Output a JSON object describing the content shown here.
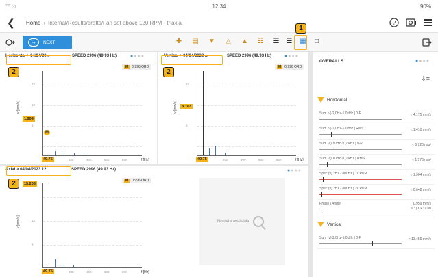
{
  "status": {
    "time": "12:34",
    "battery": "90%",
    "left": "°° ⊙"
  },
  "nav": {
    "back_icon": "chevron-left",
    "home": "Home",
    "separator": "›",
    "path": "Internal/Results/drafts/Fan set above 120 RPM - triaxial"
  },
  "toolbar": {
    "next_label": "NEXT",
    "callout": "1"
  },
  "panels": {
    "horizontal": {
      "title": "Horizontal > 04/04/20...",
      "speed": "SPEED 2996 (49.93 Hz)",
      "callout": "2",
      "mtag": "0.996 ORD",
      "ylabel": "v [mm/s]",
      "xunit": "f [Hz]",
      "yval": "1.904",
      "xval": "49.75",
      "ticks_x": [
        "200",
        "400",
        "600",
        "800"
      ],
      "ticks_y": [
        "15",
        "10",
        "5"
      ]
    },
    "vertical": {
      "title": "Vertical > 04/04/2023 ...",
      "speed": "SPEED 2996 (49.93 Hz)",
      "callout": "2",
      "mtag": "0.996 ORD",
      "ylabel": "v [mm/s]",
      "xunit": "f [Hz]",
      "yval": "8.103",
      "xval": "49.75",
      "ticks_x": [
        "200",
        "400",
        "600",
        "800"
      ],
      "ticks_y": [
        "15",
        "10",
        "5"
      ]
    },
    "axial": {
      "title": "Axial > 04/04/2023 12...",
      "speed": "SPEED 2996 (49.93 Hz)",
      "callout": "2",
      "mtag": "0.996 ORD",
      "ylabel": "v [mm/s]",
      "xunit": "f [Hz]",
      "yval": "15.208",
      "xval": "49.75",
      "ticks_x": [
        "200",
        "400",
        "600",
        "800"
      ],
      "ticks_y": [
        "10",
        "5"
      ]
    },
    "empty": {
      "text": "No data available"
    }
  },
  "overalls": {
    "title": "OVERALLS",
    "sections": [
      {
        "name": "Horizontal"
      },
      {
        "name": "Vertical"
      }
    ],
    "rows": [
      {
        "label": "Sum (v) 2,0Hz-1,0kHz | 0-P",
        "value": "≈ 4.175 mm/s"
      },
      {
        "label": "Sum (v) 2,0Hz-1,0kHz | RMS",
        "value": "≈ 1.410 mm/s"
      },
      {
        "label": "Sum (a) 10Hz-10,0kHz | 0-P",
        "value": "≈ 5.726 m/s²"
      },
      {
        "label": "Sum (a) 10Hz-10,0kHz | RMS",
        "value": "≈ 1.578 m/s²"
      },
      {
        "label": "Spec (v) 2Hz - 800Hz | 1x RPM",
        "value": "≈ 1.904 mm/s"
      },
      {
        "label": "Spec (v) 2Hz - 800Hz | 2x RPM",
        "value": "≈ 0.648 mm/s"
      },
      {
        "label": "Phase | Angle",
        "value": "0.959 mm/s",
        "value2": "0 ° | CF: 1.00"
      },
      {
        "label": "Sum (v) 2,0Hz-1,0kHz | 0-P",
        "value": "≈ 13.459 mm/s"
      }
    ]
  }
}
